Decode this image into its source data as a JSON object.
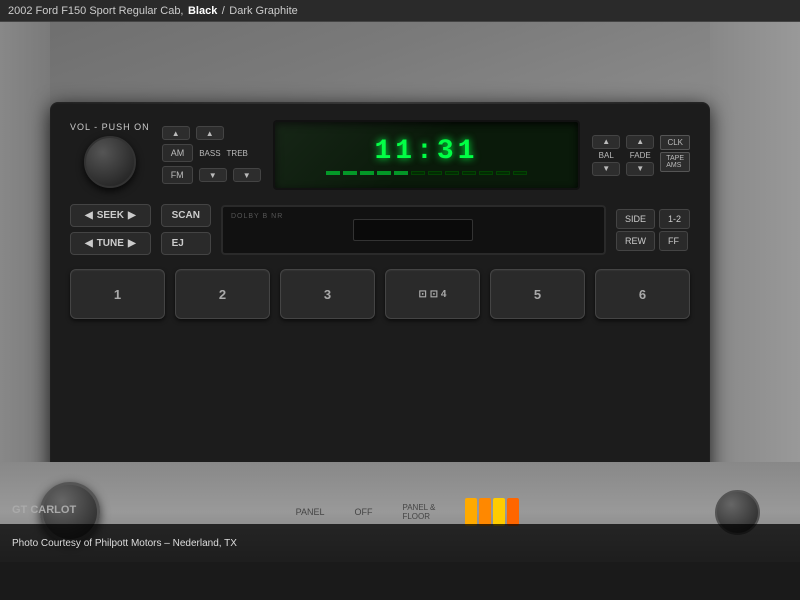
{
  "topbar": {
    "title": "2002 Ford F150 Sport Regular Cab,",
    "color1": "Black",
    "separator": "/",
    "color2": "Dark Graphite"
  },
  "radio": {
    "vol_label": "VOL - PUSH ON",
    "time_display": "11:31",
    "progress_segments": [
      1,
      1,
      1,
      1,
      1,
      0,
      0,
      0,
      0,
      0,
      0,
      0,
      0,
      0,
      0
    ],
    "am_label": "AM",
    "fm_label": "FM",
    "bass_label": "BASS",
    "treb_label": "TREB",
    "bal_label": "BAL",
    "fade_label": "FADE",
    "clk_label": "CLK",
    "tape_ams_label": "TAPE\nAMS",
    "seek_label": "SEEK",
    "tune_label": "TUNE",
    "scan_label": "SCAN",
    "ej_label": "EJ",
    "dolby_label": "DOLBY B NR",
    "side_label": "SIDE",
    "rew_label": "REW",
    "12_label": "1-2",
    "ff_label": "FF",
    "presets": [
      "1",
      "2",
      "3",
      "4",
      "5",
      "6"
    ]
  },
  "bottom_controls": {
    "panel_label": "PANEL",
    "off_label": "OFF",
    "panel_floor_label": "PANEL &\nFLOOR"
  },
  "caption": {
    "text": "Photo Courtesy of Philpott Motors – Nederland, TX"
  }
}
